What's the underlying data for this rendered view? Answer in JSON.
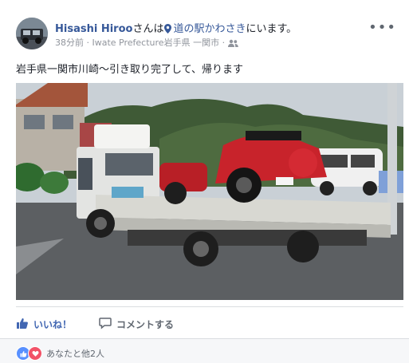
{
  "post": {
    "author": "Hisashi Hiroo",
    "author_suffix": "さんは",
    "place": "道の駅かわさき",
    "place_suffix": "にいます。",
    "time": "38分前",
    "location_meta": "Iwate Prefecture岩手県 一関市",
    "meta_separator": "·",
    "text": "岩手県一関市川崎〜引き取り完了して、帰ります"
  },
  "icons": {
    "more": "more-options-icon",
    "pin": "location-pin-icon",
    "audience": "friends-icon",
    "like": "thumbs-up-icon",
    "comment": "comment-bubble-icon",
    "reaction_like": "like-reaction-icon",
    "reaction_love": "love-reaction-icon"
  },
  "actions": {
    "like": "いいね！",
    "comment": "コメントする"
  },
  "reactions": {
    "summary": "あなたと他2人"
  },
  "colors": {
    "link_blue": "#365899",
    "like_blue": "#4267b2",
    "love_red": "#f25268"
  }
}
